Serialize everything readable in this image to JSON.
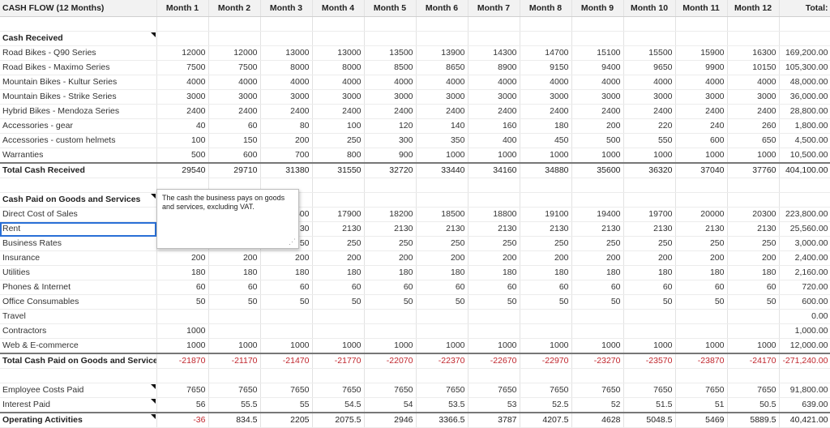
{
  "header": {
    "title": "CASH FLOW (12 Months)",
    "months": [
      "Month 1",
      "Month 2",
      "Month 3",
      "Month 4",
      "Month 5",
      "Month 6",
      "Month 7",
      "Month 8",
      "Month 9",
      "Month 10",
      "Month 11",
      "Month 12"
    ],
    "total": "Total:"
  },
  "cash_received": {
    "label": "Cash Received",
    "rows": [
      {
        "label": "Road Bikes - Q90 Series",
        "values": [
          "12000",
          "12000",
          "13000",
          "13000",
          "13500",
          "13900",
          "14300",
          "14700",
          "15100",
          "15500",
          "15900",
          "16300"
        ],
        "total": "169,200.00"
      },
      {
        "label": "Road Bikes - Maximo Series",
        "values": [
          "7500",
          "7500",
          "8000",
          "8000",
          "8500",
          "8650",
          "8900",
          "9150",
          "9400",
          "9650",
          "9900",
          "10150"
        ],
        "total": "105,300.00"
      },
      {
        "label": "Mountain Bikes - Kultur Series",
        "values": [
          "4000",
          "4000",
          "4000",
          "4000",
          "4000",
          "4000",
          "4000",
          "4000",
          "4000",
          "4000",
          "4000",
          "4000"
        ],
        "total": "48,000.00"
      },
      {
        "label": "Mountain Bikes  - Strike Series",
        "values": [
          "3000",
          "3000",
          "3000",
          "3000",
          "3000",
          "3000",
          "3000",
          "3000",
          "3000",
          "3000",
          "3000",
          "3000"
        ],
        "total": "36,000.00"
      },
      {
        "label": "Hybrid Bikes - Mendoza Series",
        "values": [
          "2400",
          "2400",
          "2400",
          "2400",
          "2400",
          "2400",
          "2400",
          "2400",
          "2400",
          "2400",
          "2400",
          "2400"
        ],
        "total": "28,800.00"
      },
      {
        "label": "Accessories - gear",
        "values": [
          "40",
          "60",
          "80",
          "100",
          "120",
          "140",
          "160",
          "180",
          "200",
          "220",
          "240",
          "260"
        ],
        "total": "1,800.00"
      },
      {
        "label": "Accessories - custom helmets",
        "values": [
          "100",
          "150",
          "200",
          "250",
          "300",
          "350",
          "400",
          "450",
          "500",
          "550",
          "600",
          "650"
        ],
        "total": "4,500.00"
      },
      {
        "label": "Warranties",
        "values": [
          "500",
          "600",
          "700",
          "800",
          "900",
          "1000",
          "1000",
          "1000",
          "1000",
          "1000",
          "1000",
          "1000"
        ],
        "total": "10,500.00"
      }
    ],
    "total": {
      "label": "Total Cash Received",
      "values": [
        "29540",
        "29710",
        "31380",
        "31550",
        "32720",
        "33440",
        "34160",
        "34880",
        "35600",
        "36320",
        "37040",
        "37760"
      ],
      "total": "404,100.00"
    }
  },
  "cash_paid": {
    "label": "Cash Paid on Goods and Services",
    "rows": [
      {
        "label": "Direct Cost of Sales",
        "values": [
          "",
          "",
          "600",
          "17900",
          "18200",
          "18500",
          "18800",
          "19100",
          "19400",
          "19700",
          "20000",
          "20300"
        ],
        "total": "223,800.00"
      },
      {
        "label": "Rent",
        "values": [
          "",
          "",
          "30",
          "2130",
          "2130",
          "2130",
          "2130",
          "2130",
          "2130",
          "2130",
          "2130",
          "2130"
        ],
        "total": "25,560.00"
      },
      {
        "label": "Business Rates",
        "values": [
          "",
          "",
          "50",
          "250",
          "250",
          "250",
          "250",
          "250",
          "250",
          "250",
          "250",
          "250"
        ],
        "total": "3,000.00"
      },
      {
        "label": "Insurance",
        "values": [
          "200",
          "200",
          "200",
          "200",
          "200",
          "200",
          "200",
          "200",
          "200",
          "200",
          "200",
          "200"
        ],
        "total": "2,400.00"
      },
      {
        "label": "Utilities",
        "values": [
          "180",
          "180",
          "180",
          "180",
          "180",
          "180",
          "180",
          "180",
          "180",
          "180",
          "180",
          "180"
        ],
        "total": "2,160.00"
      },
      {
        "label": "Phones & Internet",
        "values": [
          "60",
          "60",
          "60",
          "60",
          "60",
          "60",
          "60",
          "60",
          "60",
          "60",
          "60",
          "60"
        ],
        "total": "720.00"
      },
      {
        "label": "Office Consumables",
        "values": [
          "50",
          "50",
          "50",
          "50",
          "50",
          "50",
          "50",
          "50",
          "50",
          "50",
          "50",
          "50"
        ],
        "total": "600.00"
      },
      {
        "label": "Travel",
        "values": [
          "",
          "",
          "",
          "",
          "",
          "",
          "",
          "",
          "",
          "",
          "",
          ""
        ],
        "total": "0.00"
      },
      {
        "label": "Contractors",
        "values": [
          "1000",
          "",
          "",
          "",
          "",
          "",
          "",
          "",
          "",
          "",
          "",
          ""
        ],
        "total": "1,000.00"
      },
      {
        "label": "Web & E-commerce",
        "values": [
          "1000",
          "1000",
          "1000",
          "1000",
          "1000",
          "1000",
          "1000",
          "1000",
          "1000",
          "1000",
          "1000",
          "1000"
        ],
        "total": "12,000.00"
      }
    ],
    "total": {
      "label": "Total Cash Paid on Goods and Services",
      "values": [
        "-21870",
        "-21170",
        "-21470",
        "-21770",
        "-22070",
        "-22370",
        "-22670",
        "-22970",
        "-23270",
        "-23570",
        "-23870",
        "-24170"
      ],
      "total": "-271,240.00"
    }
  },
  "other": {
    "rows": [
      {
        "label": "Employee Costs Paid",
        "values": [
          "7650",
          "7650",
          "7650",
          "7650",
          "7650",
          "7650",
          "7650",
          "7650",
          "7650",
          "7650",
          "7650",
          "7650"
        ],
        "total": "91,800.00"
      },
      {
        "label": "Interest Paid",
        "values": [
          "56",
          "55.5",
          "55",
          "54.5",
          "54",
          "53.5",
          "53",
          "52.5",
          "52",
          "51.5",
          "51",
          "50.5"
        ],
        "total": "639.00"
      }
    ],
    "total": {
      "label": "Operating Activities",
      "values": [
        "-36",
        "834.5",
        "2205",
        "2075.5",
        "2946",
        "3366.5",
        "3787",
        "4207.5",
        "4628",
        "5048.5",
        "5469",
        "5889.5"
      ],
      "total": "40,421.00"
    }
  },
  "comment": {
    "text": "The cash the business pays on goods and services, excluding VAT."
  },
  "colors": {
    "negative": "#c0262d",
    "selection": "#2a6fd6"
  }
}
